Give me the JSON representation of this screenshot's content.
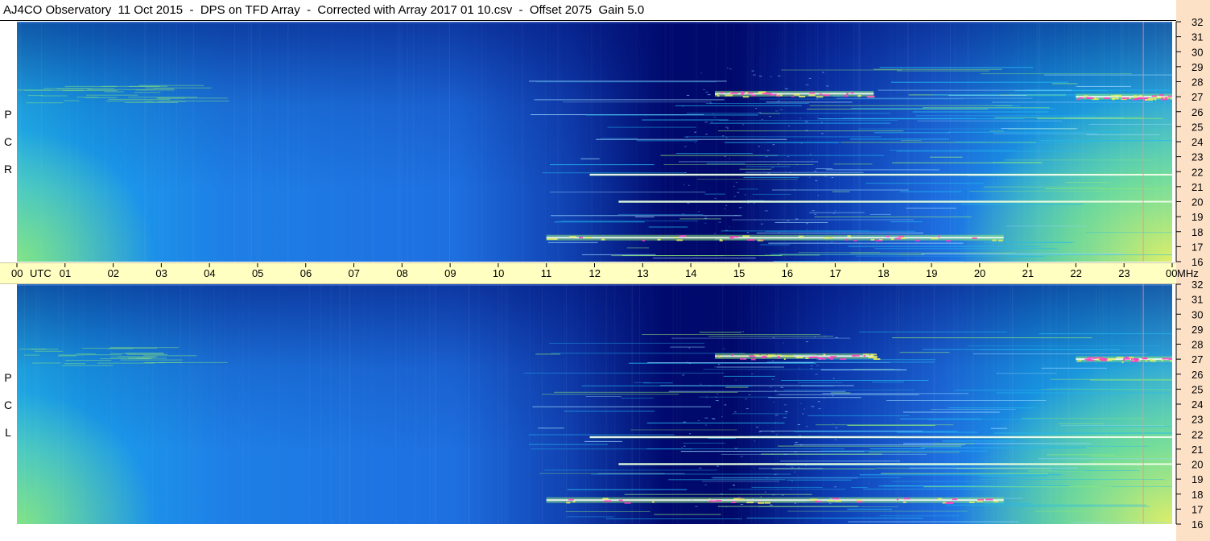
{
  "header": {
    "title": "AJ4CO Observatory  11 Oct 2015  -  DPS on TFD Array  -  Corrected with Array 2017 01 10.csv  -  Offset 2075  Gain 5.0"
  },
  "panels": {
    "top_label": [
      "R",
      "C",
      "P"
    ],
    "bottom_label": [
      "L",
      "C",
      "P"
    ]
  },
  "time_axis": {
    "ticks": [
      "00",
      "01",
      "02",
      "03",
      "04",
      "05",
      "06",
      "07",
      "08",
      "09",
      "10",
      "11",
      "12",
      "13",
      "14",
      "15",
      "16",
      "17",
      "18",
      "19",
      "20",
      "21",
      "22",
      "23",
      "00"
    ],
    "start_unit": "UTC",
    "end_unit": "MHz"
  },
  "freq_axis": {
    "ticks": [
      "32",
      "31",
      "30",
      "29",
      "28",
      "27",
      "26",
      "25",
      "24",
      "23",
      "22",
      "21",
      "20",
      "19",
      "18",
      "17",
      "16"
    ]
  },
  "colors": {
    "background_blue": "#1e6fe0",
    "dark_blue": "#000a6e",
    "cyan": "#23b9f0",
    "green": "#8ce87a",
    "yellow": "#e8f060",
    "magenta": "#ff40c0",
    "white": "#ffffff",
    "time_bar": "#ffffc2",
    "freq_bar": "#fde1c7"
  },
  "chart_data": {
    "type": "heatmap",
    "title": "AJ4CO Observatory  11 Oct 2015  -  DPS on TFD Array  -  Corrected with Array 2017 01 10.csv  -  Offset 2075  Gain 5.0",
    "xlabel": "UTC",
    "ylabel": "MHz",
    "xlim": [
      0,
      24
    ],
    "ylim": [
      16,
      32
    ],
    "panels": [
      "RCP",
      "LCP"
    ],
    "features": [
      {
        "name": "RFI band",
        "freq": 27.2,
        "start": 14.5,
        "end": 17.8,
        "level": "high"
      },
      {
        "name": "RFI band",
        "freq": 27.0,
        "start": 22.0,
        "end": 24.0,
        "level": "high"
      },
      {
        "name": "RFI band",
        "freq": 17.6,
        "start": 11.0,
        "end": 20.5,
        "level": "high"
      },
      {
        "name": "RFI band",
        "freq": 21.8,
        "start": 11.9,
        "end": 24.0,
        "level": "medium"
      },
      {
        "name": "RFI band",
        "freq": 20.0,
        "start": 12.5,
        "end": 24.0,
        "level": "medium"
      }
    ]
  }
}
